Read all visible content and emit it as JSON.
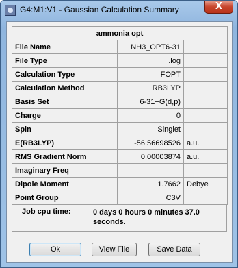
{
  "window": {
    "title": "G4:M1:V1 - Gaussian Calculation Summary",
    "close_glyph": "X",
    "icon": "gaussview-app-icon"
  },
  "summary": {
    "header": "ammonia opt",
    "rows": [
      {
        "label": "File Name",
        "value": "NH3_OPT6-31",
        "unit": ""
      },
      {
        "label": "File Type",
        "value": ".log",
        "unit": ""
      },
      {
        "label": "Calculation Type",
        "value": "FOPT",
        "unit": ""
      },
      {
        "label": "Calculation Method",
        "value": "RB3LYP",
        "unit": ""
      },
      {
        "label": "Basis Set",
        "value": "6-31+G(d,p)",
        "unit": ""
      },
      {
        "label": "Charge",
        "value": "0",
        "unit": ""
      },
      {
        "label": "Spin",
        "value": "Singlet",
        "unit": ""
      },
      {
        "label": "E(RB3LYP)",
        "value": "-56.56698526",
        "unit": "a.u."
      },
      {
        "label": "RMS Gradient Norm",
        "value": "0.00003874",
        "unit": "a.u."
      },
      {
        "label": "Imaginary Freq",
        "value": "",
        "unit": ""
      },
      {
        "label": "Dipole Moment",
        "value": "1.7662",
        "unit": "Debye"
      },
      {
        "label": "Point Group",
        "value": "C3V",
        "unit": ""
      }
    ],
    "cpu_label": "Job cpu time:",
    "cpu_value": "0 days  0 hours  0 minutes 37.0 seconds."
  },
  "buttons": {
    "ok": "Ok",
    "view_file": "View File",
    "save_data": "Save Data"
  }
}
